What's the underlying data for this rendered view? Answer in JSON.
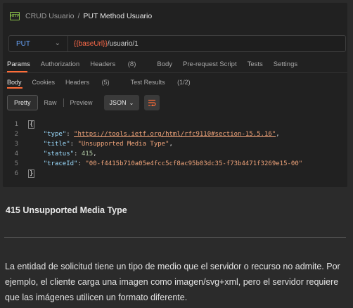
{
  "breadcrumb": {
    "icon_label": "HTTP",
    "parent": "CRUD Usuario",
    "separator": "/",
    "current": "PUT Method Usuario"
  },
  "request": {
    "method": "PUT",
    "url_variable": "{{baseUrl}}",
    "url_path": "/usuario/1"
  },
  "request_tabs": [
    {
      "label": "Params",
      "active": true
    },
    {
      "label": "Authorization"
    },
    {
      "label": "Headers",
      "count": "(8)"
    },
    {
      "label": "Body"
    },
    {
      "label": "Pre-request Script"
    },
    {
      "label": "Tests"
    },
    {
      "label": "Settings"
    }
  ],
  "response_tabs": [
    {
      "label": "Body",
      "active": true
    },
    {
      "label": "Cookies"
    },
    {
      "label": "Headers",
      "count": "(5)"
    },
    {
      "label": "Test Results",
      "count": "(1/2)"
    }
  ],
  "view_modes": {
    "pretty": "Pretty",
    "raw": "Raw",
    "preview": "Preview"
  },
  "format": {
    "selected": "JSON"
  },
  "icons": {
    "chevron": "chevron-down-icon",
    "wrap": "wrap-lines-icon",
    "http": "http-file-icon"
  },
  "code": {
    "line_numbers": [
      "1",
      "2",
      "3",
      "4",
      "5",
      "6"
    ],
    "open_brace": "{",
    "close_brace": "}",
    "lines": [
      {
        "key": "\"type\"",
        "value": "\"https://tools.ietf.org/html/rfc9110#section-15.5.16\"",
        "value_kind": "link"
      },
      {
        "key": "\"title\"",
        "value": "\"Unsupported Media Type\"",
        "value_kind": "str"
      },
      {
        "key": "\"status\"",
        "value": "415",
        "value_kind": "num"
      },
      {
        "key": "\"traceId\"",
        "value": "\"00-f4415b710a05e4fcc5cf8ac95b03dc35-f73b4471f3269e15-00\"",
        "value_kind": "str"
      }
    ]
  },
  "doc": {
    "heading": "415 Unsupported Media Type",
    "paragraph": "La entidad de solicitud tiene un tipo de medio que el servidor o recurso no admite. Por ejemplo, el cliente carga una imagen como imagen/svg+xml, pero el servidor requiere que las imágenes utilicen un formato diferente."
  },
  "colors": {
    "accent": "#ff6c37",
    "method": "#6aa7ff",
    "variable": "#ff6b4a"
  }
}
